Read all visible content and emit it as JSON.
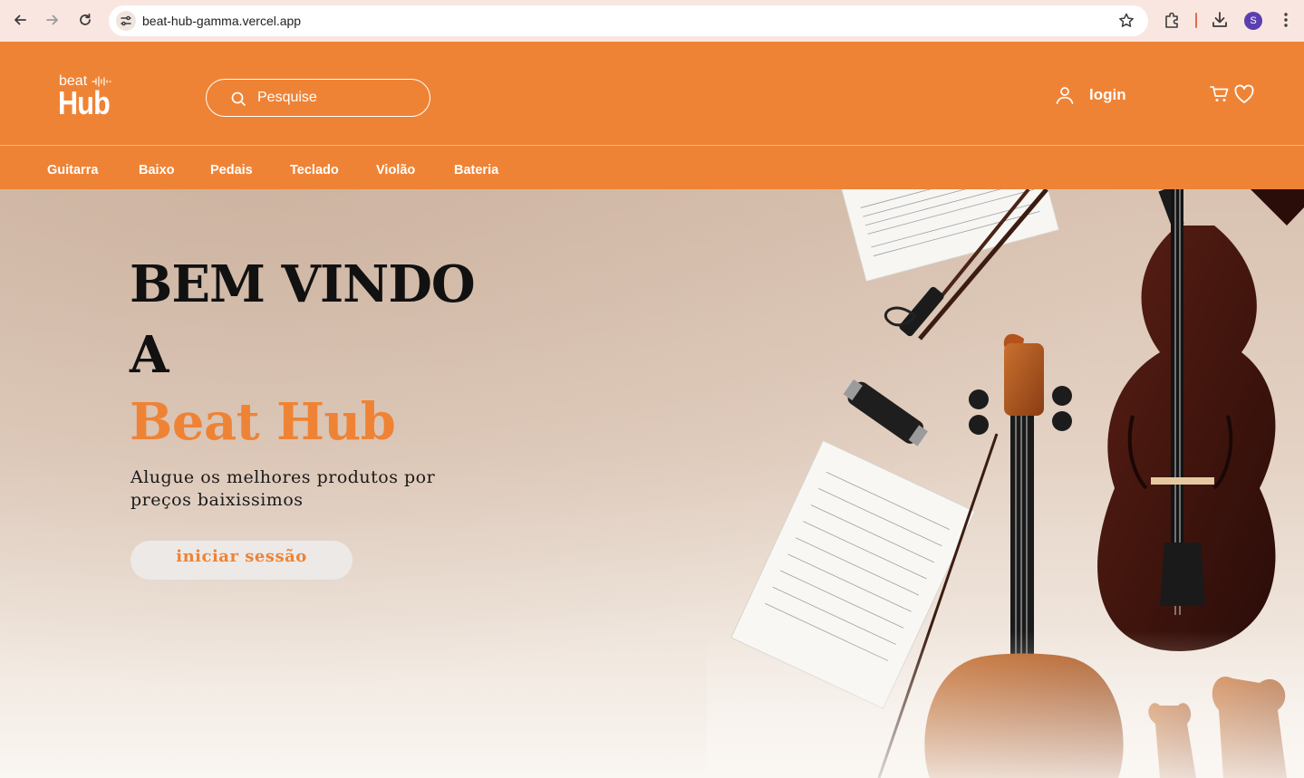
{
  "browser": {
    "url": "beat-hub-gamma.vercel.app",
    "avatar_initial": "S",
    "icons": [
      "back-icon",
      "forward-icon",
      "reload-icon",
      "site-settings-icon",
      "bookmark-star-icon",
      "extensions-icon",
      "download-icon",
      "kebab-menu-icon"
    ]
  },
  "header": {
    "logo_top": "beat",
    "logo_bottom": "Hub",
    "search_placeholder": "Pesquise",
    "login_label": "login",
    "icons": [
      "user-icon",
      "cart-icon",
      "heart-icon",
      "search-icon"
    ]
  },
  "categories": [
    "Guitarra",
    "Baixo",
    "Pedais",
    "Teclado",
    "Violão",
    "Bateria"
  ],
  "hero": {
    "line1": "BEM VINDO",
    "line2": "A",
    "line3": "Beat Hub",
    "tagline": "Alugue os melhores produtos por preços baixissimos",
    "cta_label": "iniciar sessão"
  },
  "colors": {
    "brand_orange": "#ef8335",
    "chrome_bg": "#f9e6e0",
    "cta_bg": "#ece9e7"
  }
}
